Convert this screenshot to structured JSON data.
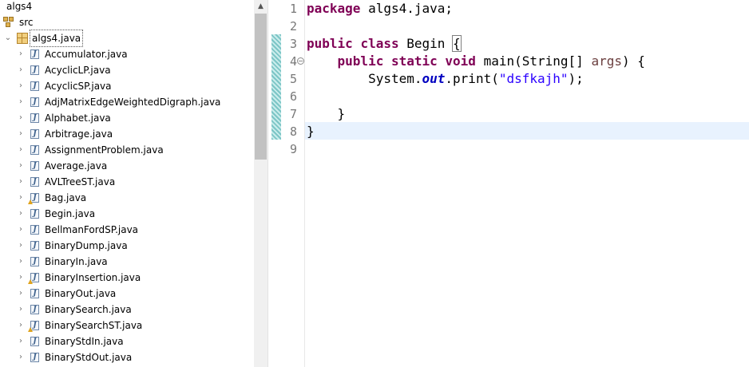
{
  "explorer": {
    "project": "algs4",
    "source_folder": "src",
    "package": "algs4.java",
    "files": [
      {
        "name": "Accumulator.java",
        "warning": false
      },
      {
        "name": "AcyclicLP.java",
        "warning": false
      },
      {
        "name": "AcyclicSP.java",
        "warning": false
      },
      {
        "name": "AdjMatrixEdgeWeightedDigraph.java",
        "warning": false
      },
      {
        "name": "Alphabet.java",
        "warning": false
      },
      {
        "name": "Arbitrage.java",
        "warning": false
      },
      {
        "name": "AssignmentProblem.java",
        "warning": false
      },
      {
        "name": "Average.java",
        "warning": false
      },
      {
        "name": "AVLTreeST.java",
        "warning": false
      },
      {
        "name": "Bag.java",
        "warning": true
      },
      {
        "name": "Begin.java",
        "warning": false
      },
      {
        "name": "BellmanFordSP.java",
        "warning": false
      },
      {
        "name": "BinaryDump.java",
        "warning": false
      },
      {
        "name": "BinaryIn.java",
        "warning": false
      },
      {
        "name": "BinaryInsertion.java",
        "warning": true
      },
      {
        "name": "BinaryOut.java",
        "warning": false
      },
      {
        "name": "BinarySearch.java",
        "warning": false
      },
      {
        "name": "BinarySearchST.java",
        "warning": true
      },
      {
        "name": "BinaryStdIn.java",
        "warning": false
      },
      {
        "name": "BinaryStdOut.java",
        "warning": false
      }
    ]
  },
  "editor": {
    "line_numbers": [
      "1",
      "2",
      "3",
      "4",
      "5",
      "6",
      "7",
      "8",
      "9"
    ],
    "fold_marker": "−",
    "code": {
      "l1_kw": "package",
      "l1_rest": " algs4.java;",
      "l3_kw1": "public",
      "l3_kw2": "class",
      "l3_name": " Begin ",
      "l3_brace": "{",
      "l4_indent": "    ",
      "l4_kw1": "public",
      "l4_kw2": "static",
      "l4_kw3": "void",
      "l4_sig": " main(String[] ",
      "l4_param": "args",
      "l4_end": ") {",
      "l5_indent": "        ",
      "l5_obj": "System.",
      "l5_field": "out",
      "l5_call": ".print(",
      "l5_str": "\"dsfkajh\"",
      "l5_end": ");",
      "l7": "    }",
      "l8": "}"
    }
  },
  "icons": {
    "chevron_right": "›",
    "chevron_down": "⌄",
    "scroll_up": "▲"
  }
}
